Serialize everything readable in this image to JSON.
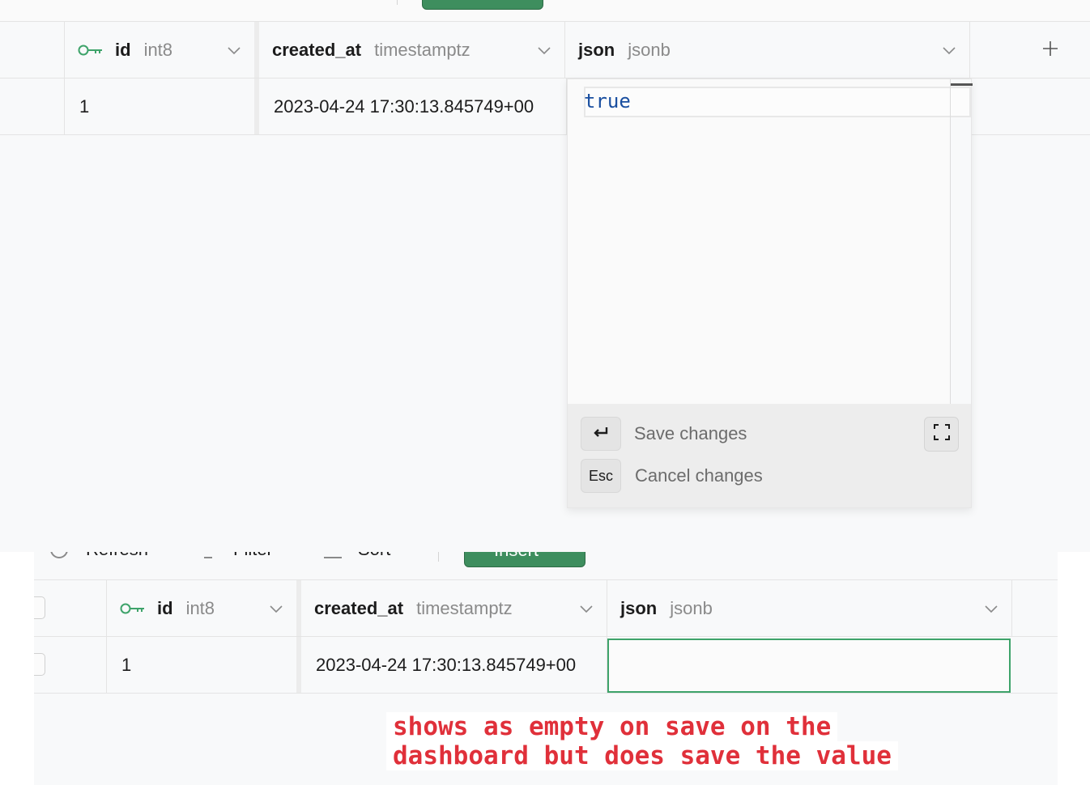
{
  "columns": [
    {
      "name": "id",
      "type": "int8",
      "primary_key": true
    },
    {
      "name": "created_at",
      "type": "timestamptz"
    },
    {
      "name": "json",
      "type": "jsonb"
    }
  ],
  "rows": [
    {
      "id": "1",
      "created_at": "2023-04-24 17:30:13.845749+00"
    }
  ],
  "editor": {
    "value": "true",
    "save_key": "↵",
    "save_label": "Save changes",
    "cancel_key": "Esc",
    "cancel_label": "Cancel changes"
  },
  "toolbar": {
    "refresh_label": "Refresh",
    "filter_label": "Filter",
    "sort_label": "Sort",
    "insert_label": "Insert"
  },
  "annotation": {
    "line1": "shows as empty on save on the",
    "line2": "dashboard but does save the value"
  },
  "colors": {
    "accent_green": "#3ea36a",
    "annotation_red": "#e0303a",
    "json_blue": "#1a4fa0"
  },
  "icons": [
    "key-icon",
    "chevron-down-icon",
    "plus-icon",
    "enter-icon",
    "expand-icon",
    "refresh-icon",
    "filter-icon",
    "sort-icon"
  ]
}
